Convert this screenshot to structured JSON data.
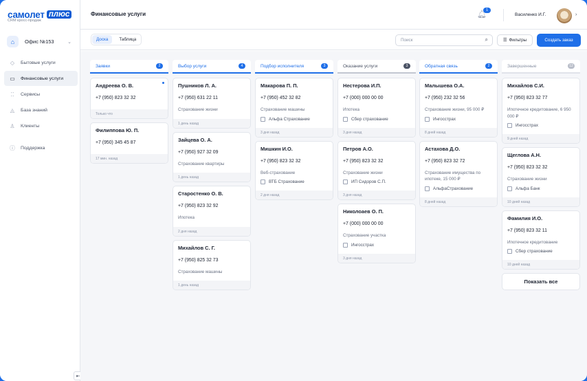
{
  "brand": {
    "word1": "самолет",
    "word2": "плюс",
    "subtitle": "CRM кросс-продаж"
  },
  "office": {
    "label": "Офис №153"
  },
  "nav": [
    "Бытовые услуги",
    "Финансовые услуги",
    "Сервисы",
    "База знаний",
    "Клиенты",
    "Поддержка"
  ],
  "header": {
    "title": "Финансовые услуги",
    "notifications": "1",
    "user": "Василенко И.Г."
  },
  "toolbar": {
    "tab_board": "Доска",
    "tab_table": "Таблица",
    "search_placeholder": "Поиск",
    "filters": "Фильтры",
    "create": "Создать заказ"
  },
  "columns": [
    {
      "title": "Заявки",
      "count": "2",
      "cards": [
        {
          "name": "Андреева О. В.",
          "phone": "+7 (950) 823 32 32",
          "service": "",
          "company": "",
          "time": "Только что",
          "dot": true
        },
        {
          "name": "Филиппова Ю. П.",
          "phone": "+7 (950) 345 45 87",
          "service": "",
          "company": "",
          "time": "17 мин. назад"
        }
      ]
    },
    {
      "title": "Выбор услуги",
      "count": "4",
      "cards": [
        {
          "name": "Пушников Л. А.",
          "phone": "+7 (950) 631 22 11",
          "service": "Страхование жизни",
          "company": "",
          "time": "1 день назад"
        },
        {
          "name": "Зайцева О. А.",
          "phone": "+7 (950) 927 32 09",
          "service": "Страхование квартиры",
          "company": "",
          "time": "1 день назад"
        },
        {
          "name": "Старостенко О. В.",
          "phone": "+7 (950) 823 32 92",
          "service": "Ипотека",
          "company": "",
          "time": "2 дня назад"
        },
        {
          "name": "Михайлов С. Г.",
          "phone": "+7 (950) 825 32 73",
          "service": "Страхование машины",
          "company": "",
          "time": "1 день назад"
        }
      ]
    },
    {
      "title": "Подбор исполнителя",
      "count": "3",
      "cards": [
        {
          "name": "Макарова П. П.",
          "phone": "+7 (950) 452 32 82",
          "service": "Страхование машины",
          "company": "Альфа Страхование",
          "time": "3 дня назад"
        },
        {
          "name": "Мишкин И.О.",
          "phone": "+7 (950) 823 32 32",
          "service": "Веб-страхование",
          "company": "ВТБ Страхование",
          "time": "2 дня назад"
        }
      ]
    },
    {
      "title": "Оказание услуги",
      "count": "3",
      "cards": [
        {
          "name": "Нестерова И.П.",
          "phone": "+7 (000) 000 00 00",
          "service": "Ипотека",
          "company": "Сбер страхование",
          "time": "3 дня назад"
        },
        {
          "name": "Петров А.О.",
          "phone": "+7 (950) 823 32 32",
          "service": "Страхование жизни",
          "company": "ИП Сидоров С.П.",
          "time": "3 дня назад"
        },
        {
          "name": "Николоаев О. П.",
          "phone": "+7 (000) 000 00 00",
          "service": "Страхование участка",
          "company": "Ингосстрах",
          "time": "3 дня назад"
        }
      ]
    },
    {
      "title": "Обратная связь",
      "count": "2",
      "cards": [
        {
          "name": "Малышева О.А.",
          "phone": "+7 (950) 232 32 56",
          "service": "Страхование жизни, 95 000 ₽",
          "company": "Ингосстрах",
          "time": "8 дней назад"
        },
        {
          "name": "Астахова Д.О.",
          "phone": "+7 (950) 823 32 72",
          "service": "Страхование имущества по ипотеке, 15 000 ₽",
          "company": "АльфаСтрахование",
          "time": "8 дней назад"
        }
      ]
    },
    {
      "title": "Завершенные",
      "count": "12",
      "cards": [
        {
          "name": "Михайлов С.И.",
          "phone": "+7 (950) 823 32 77",
          "service": "Ипотечное кредитование, 6 950 000 ₽",
          "company": "Ингосстрах",
          "time": "9 дней назад"
        },
        {
          "name": "Щеглова А.Н.",
          "phone": "+7 (950) 823 32 32",
          "service": "Страхование жизни",
          "company": "Альфа Банк",
          "time": "10 дней назад"
        },
        {
          "name": "Фамилия И.О.",
          "phone": "+7 (950) 823 32 11",
          "service": "Ипотечное кредитование",
          "company": "Сбер страхование",
          "time": "10 дней назад"
        }
      ],
      "show_all": "Показать все"
    }
  ]
}
